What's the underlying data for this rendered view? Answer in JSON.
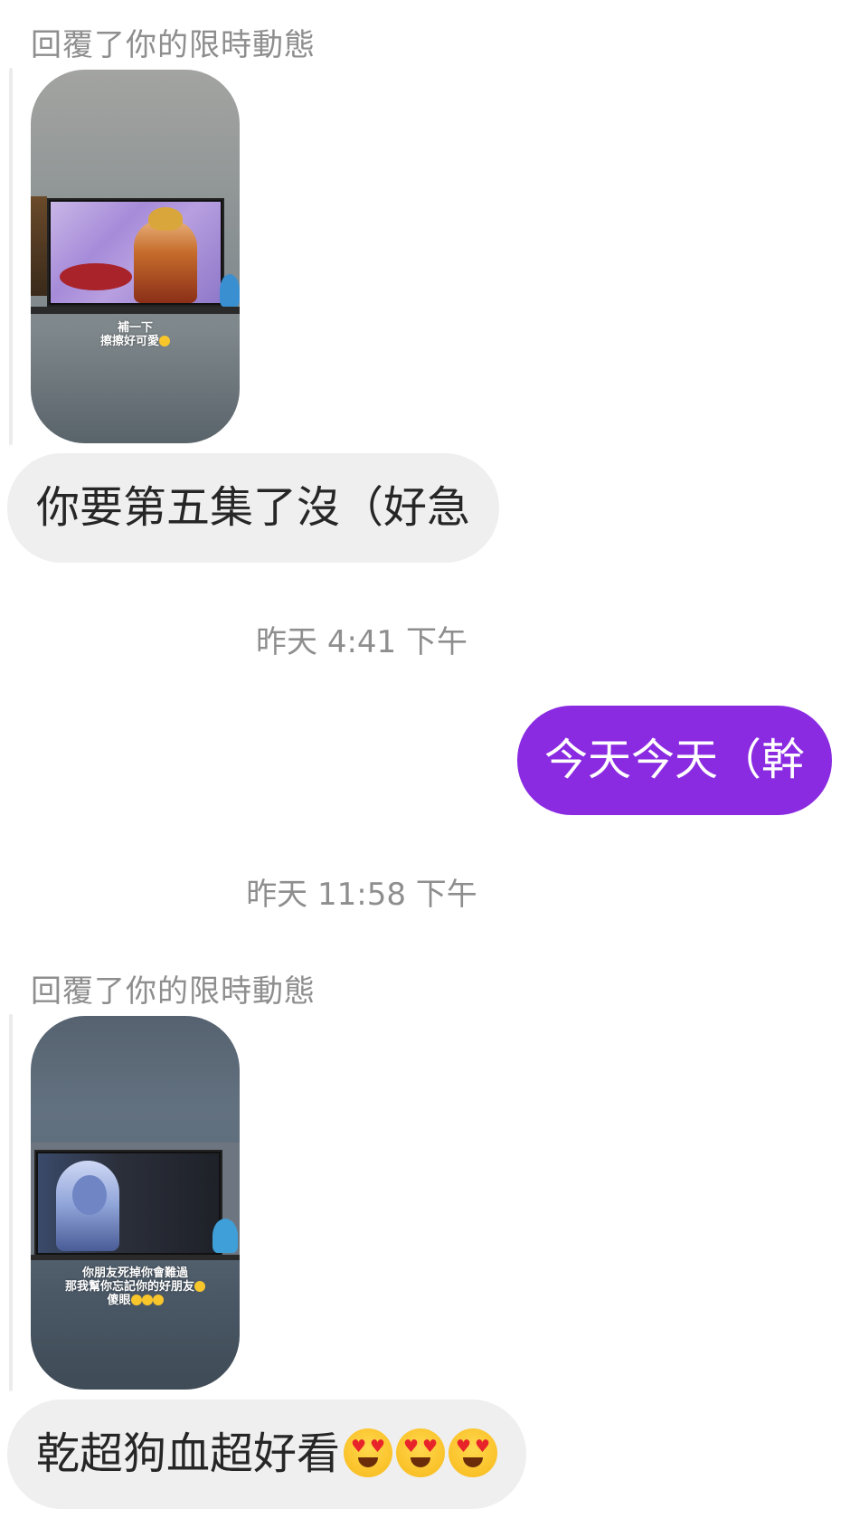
{
  "messages": {
    "reply_label_1": "回覆了你的限時動態",
    "story_1": {
      "caption_line_1": "補一下",
      "caption_line_2": "擦擦好可愛"
    },
    "bubble_1": "你要第五集了沒（好急",
    "timestamp_1": "昨天 4:41 下午",
    "bubble_out_1": "今天今天（幹",
    "timestamp_2": "昨天 11:58 下午",
    "reply_label_2": "回覆了你的限時動態",
    "story_2": {
      "caption_line_1": "你朋友死掉你會難過",
      "caption_line_2": "那我幫你忘記你的好朋友",
      "caption_line_3": "傻眼"
    },
    "bubble_2": "乾超狗血超好看"
  },
  "colors": {
    "incoming_bubble": "#efefef",
    "outgoing_bubble": "#8a2be2",
    "meta_text": "#8e8e8e"
  },
  "icons": {
    "emoji": "smiling-face-with-heart-eyes"
  }
}
